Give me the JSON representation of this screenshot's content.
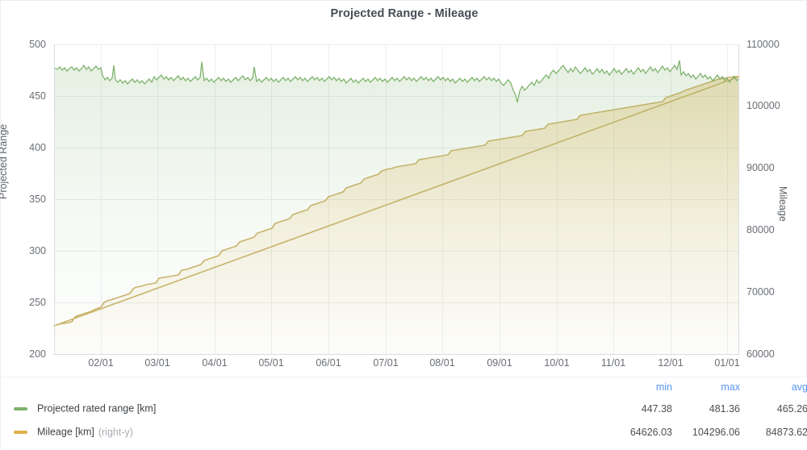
{
  "panel": {
    "title": "Projected Range - Mileage"
  },
  "legend": {
    "columns": [
      "min",
      "max",
      "avg"
    ],
    "series": [
      {
        "name": "Projected rated range [km]",
        "axis_note": "",
        "color": "#7eb26d",
        "min": "447.38",
        "max": "481.36",
        "avg": "465.26"
      },
      {
        "name": "Mileage [km]",
        "axis_note": "(right-y)",
        "color": "#e0b04a",
        "min": "64626.03",
        "max": "104296.06",
        "avg": "84873.62"
      }
    ]
  },
  "chart_data": {
    "type": "line",
    "title": "Projected Range - Mileage",
    "xlabel": "",
    "ylabel": "Projected Range",
    "y2label": "Mileage",
    "grid": true,
    "legend_position": "bottom",
    "x": [
      "02/01",
      "03/01",
      "04/01",
      "05/01",
      "06/01",
      "07/01",
      "08/01",
      "09/01",
      "10/01",
      "11/01",
      "12/01",
      "01/01"
    ],
    "xtick_labels": [
      "02/01",
      "03/01",
      "04/01",
      "05/01",
      "06/01",
      "07/01",
      "08/01",
      "09/01",
      "10/01",
      "11/01",
      "12/01",
      "01/01"
    ],
    "ylim": [
      200,
      500
    ],
    "ytick_labels": [
      "200",
      "250",
      "300",
      "350",
      "400",
      "450",
      "500"
    ],
    "y2lim": [
      60000,
      110000
    ],
    "y2tick_labels": [
      "60000",
      "70000",
      "80000",
      "90000",
      "100000",
      "110000"
    ],
    "series": [
      {
        "name": "Projected rated range [km]",
        "axis": "left",
        "color": "#7eb26d",
        "fill": "area-gradient",
        "units": "km",
        "stats": {
          "min": 447.38,
          "max": 481.36,
          "avg": 465.26
        },
        "values_monthly": [
          477,
          473,
          468,
          466,
          466,
          467,
          466,
          464,
          462,
          466,
          468,
          465,
          459
        ]
      },
      {
        "name": "Mileage [km]",
        "axis": "right",
        "color": "#e0b04a",
        "fill": "area-gradient",
        "units": "km",
        "stats": {
          "min": 64626.03,
          "max": 104296.06,
          "avg": 84873.62
        },
        "values_monthly": [
          64626,
          67700,
          71500,
          75300,
          79500,
          83500,
          87200,
          90300,
          93300,
          96900,
          100400,
          103200,
          104296
        ]
      }
    ]
  }
}
